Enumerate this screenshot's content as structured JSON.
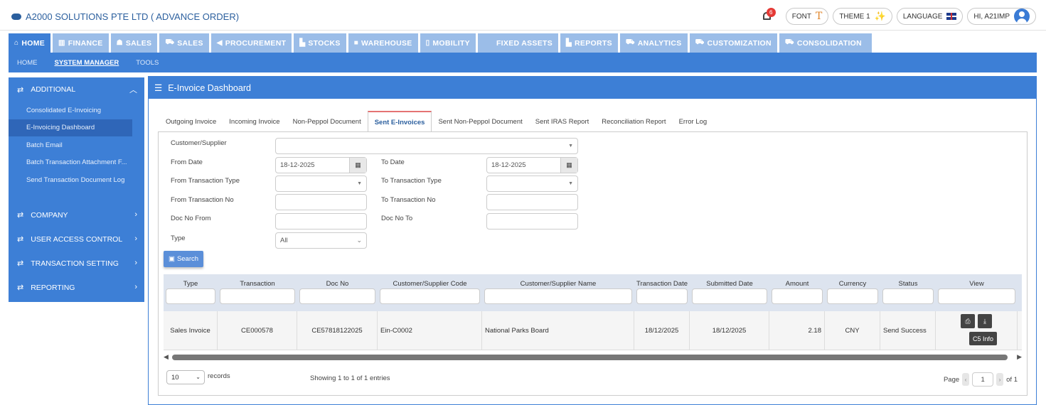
{
  "header": {
    "title": "A2000 SOLUTIONS PTE LTD ( ADVANCE ORDER)",
    "notification_count": "6",
    "font_label": "FONT",
    "theme_label": "THEME 1",
    "language_label": "LANGUAGE",
    "user_label": "HI, A21IMP"
  },
  "menu": {
    "tabs": [
      {
        "label": "HOME",
        "icon": "home-icon"
      },
      {
        "label": "FINANCE",
        "icon": "bank-icon"
      },
      {
        "label": "SALES",
        "icon": "users-icon"
      },
      {
        "label": "SALES",
        "icon": "cart-icon"
      },
      {
        "label": "PROCUREMENT",
        "icon": "megaphone-icon"
      },
      {
        "label": "STOCKS",
        "icon": "bar-chart-icon"
      },
      {
        "label": "WAREHOUSE",
        "icon": "warehouse-icon"
      },
      {
        "label": "MOBILITY",
        "icon": "mobile-icon"
      },
      {
        "label": "FIXED ASSETS",
        "icon": "asset-icon"
      },
      {
        "label": "REPORTS",
        "icon": "chart-icon"
      },
      {
        "label": "ANALYTICS",
        "icon": "cart-icon"
      },
      {
        "label": "CUSTOMIZATION",
        "icon": "cart-icon"
      },
      {
        "label": "CONSOLIDATION",
        "icon": "cart-icon"
      }
    ],
    "sub": [
      "HOME",
      "SYSTEM MANAGER",
      "TOOLS"
    ]
  },
  "sidebar": {
    "groups": [
      {
        "label": "ADDITIONAL",
        "items": [
          "Consolidated E-Invoicing",
          "E-Invoicing Dashboard",
          "Batch Email",
          "Batch Transaction Attachment F...",
          "Send Transaction Document Log"
        ]
      },
      {
        "label": "COMPANY"
      },
      {
        "label": "USER ACCESS CONTROL"
      },
      {
        "label": "TRANSACTION SETTING"
      },
      {
        "label": "REPORTING"
      }
    ]
  },
  "panel": {
    "title": "E-Invoice Dashboard",
    "tabs": [
      "Outgoing Invoice",
      "Incoming Invoice",
      "Non-Peppol Document",
      "Sent E-Invoices",
      "Sent Non-Peppol Document",
      "Sent IRAS Report",
      "Reconciliation Report",
      "Error Log"
    ]
  },
  "form": {
    "customer_label": "Customer/Supplier",
    "from_date_label": "From Date",
    "from_date_value": "18-12-2025",
    "to_date_label": "To Date",
    "to_date_value": "18-12-2025",
    "from_type_label": "From Transaction Type",
    "to_type_label": "To Transaction Type",
    "from_no_label": "From Transaction No",
    "to_no_label": "To Transaction No",
    "doc_from_label": "Doc No From",
    "doc_to_label": "Doc No To",
    "type_label": "Type",
    "type_value": "All",
    "search_label": "Search"
  },
  "table": {
    "columns": [
      "Type",
      "Transaction",
      "Doc No",
      "Customer/Supplier Code",
      "Customer/Supplier Name",
      "Transaction Date",
      "Submitted Date",
      "Amount",
      "Currency",
      "Status",
      "View"
    ],
    "rows": [
      [
        "Sales Invoice",
        "CE000578",
        "CE57818122025",
        "Ein-C0002",
        "National Parks Board",
        "18/12/2025",
        "18/12/2025",
        "2.18",
        "CNY",
        "Send Success"
      ]
    ],
    "tooltip": "C5 Info"
  },
  "footer": {
    "page_size": "10",
    "records_label": "records",
    "showing": "Showing 1 to 1 of 1 entries",
    "page_label": "Page",
    "page_value": "1",
    "of_label": "of 1"
  }
}
